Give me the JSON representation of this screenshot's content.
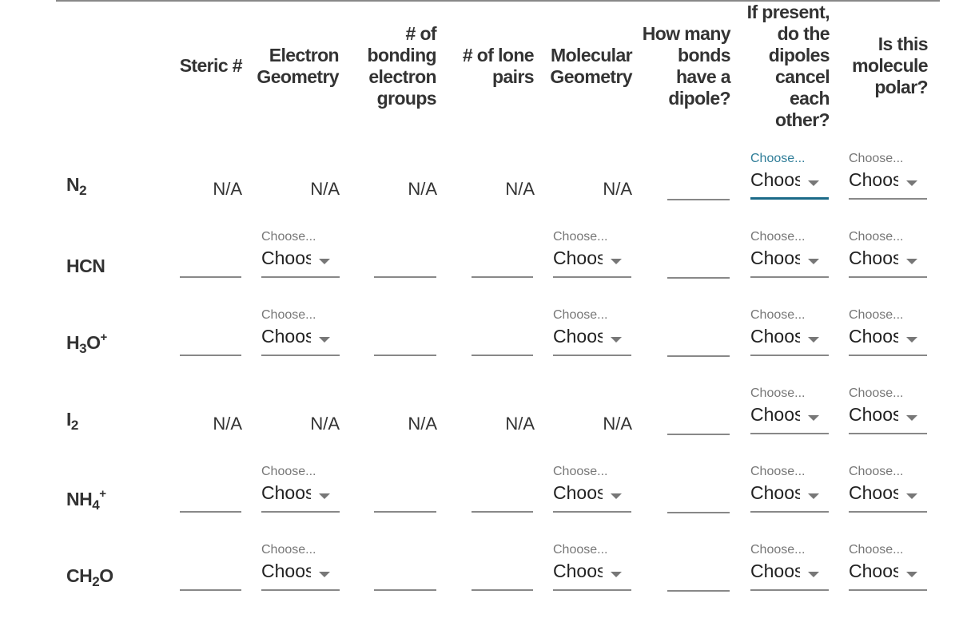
{
  "headers": {
    "steric": "Steric #",
    "electron_geometry": "Electron\nGeometry",
    "bonding_groups": "# of\nbonding\nelectron\ngroups",
    "lone_pairs": "# of lone\npairs",
    "molecular_geometry": "Molecular\nGeometry",
    "bonds_dipole": "How many\nbonds\nhave a\ndipole?",
    "dipoles_cancel": "If present,\ndo the\ndipoles\ncancel\neach\nother?",
    "is_polar": "Is this\nmolecule\npolar?"
  },
  "select": {
    "label": "Choose...",
    "value": "Choose..."
  },
  "na": "N/A",
  "rows": [
    {
      "molecule": {
        "base": "N",
        "sub": "2",
        "tail": "",
        "sup": ""
      },
      "type": "na"
    },
    {
      "molecule": {
        "base": "HCN",
        "sub": "",
        "tail": "",
        "sup": ""
      },
      "type": "input"
    },
    {
      "molecule": {
        "base": "H",
        "sub": "3",
        "tail": "O",
        "sup": "+"
      },
      "type": "input"
    },
    {
      "molecule": {
        "base": "I",
        "sub": "2",
        "tail": "",
        "sup": ""
      },
      "type": "na"
    },
    {
      "molecule": {
        "base": "NH",
        "sub": "4",
        "tail": "",
        "sup": "+"
      },
      "type": "input"
    },
    {
      "molecule": {
        "base": "CH",
        "sub": "2",
        "tail": "O",
        "sup": ""
      },
      "type": "input"
    }
  ]
}
